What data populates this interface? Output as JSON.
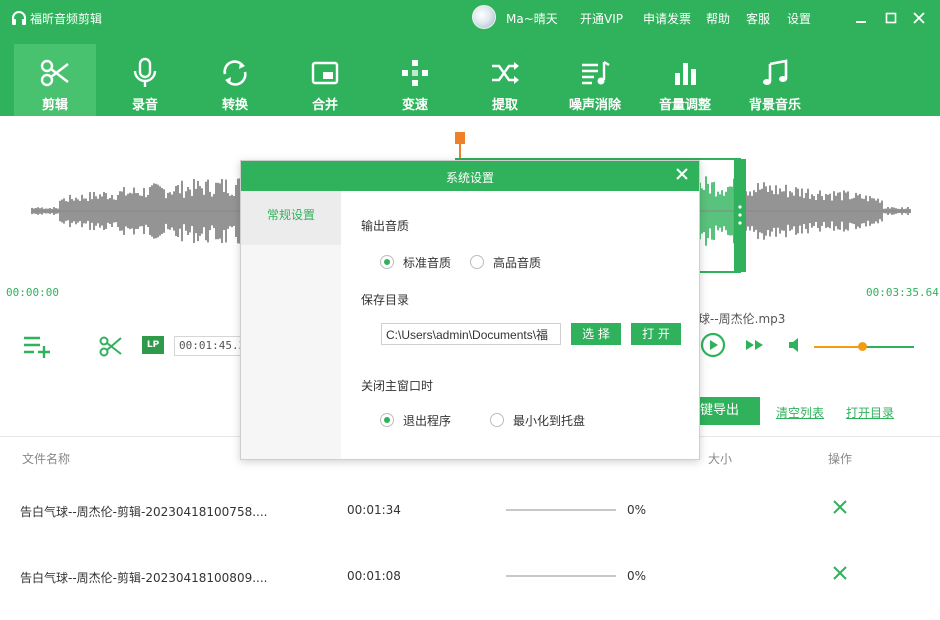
{
  "app": {
    "title": "福昕音频剪辑",
    "username": "Ma~晴天"
  },
  "top_links": [
    {
      "label": "开通VIP"
    },
    {
      "label": "申请发票"
    },
    {
      "label": "帮助"
    },
    {
      "label": "客服"
    },
    {
      "label": "设置"
    }
  ],
  "tools": [
    {
      "label": "剪辑",
      "icon": "scissors-icon",
      "active": true
    },
    {
      "label": "录音",
      "icon": "microphone-icon"
    },
    {
      "label": "转换",
      "icon": "convert-icon"
    },
    {
      "label": "合并",
      "icon": "merge-icon"
    },
    {
      "label": "变速",
      "icon": "speed-icon"
    },
    {
      "label": "提取",
      "icon": "extract-icon"
    },
    {
      "label": "噪声消除",
      "icon": "noise-icon"
    },
    {
      "label": "音量调整",
      "icon": "volume-bars-icon"
    },
    {
      "label": "背景音乐",
      "icon": "music-note-icon"
    }
  ],
  "waveform": {
    "start_time": "00:00:00",
    "end_time": "00:03:35.64"
  },
  "controls": {
    "lp_badge": "LP",
    "time_value": "00:01:45.3",
    "file_name": "球--周杰伦.mp3",
    "volume_level": 0.48
  },
  "actions": {
    "export": "键导出",
    "clear_list": "清空列表",
    "open_dir": "打开目录"
  },
  "table": {
    "headers": {
      "name": "文件名称",
      "size": "大小",
      "action": "操作"
    },
    "rows": [
      {
        "name": "告白气球--周杰伦-剪辑-20230418100758....",
        "duration": "00:01:34",
        "progress": "0%"
      },
      {
        "name": "告白气球--周杰伦-剪辑-20230418100809....",
        "duration": "00:01:08",
        "progress": "0%"
      }
    ]
  },
  "dialog": {
    "title": "系统设置",
    "side_tab": "常规设置",
    "quality_label": "输出音质",
    "quality_options": [
      {
        "label": "标准音质",
        "checked": true
      },
      {
        "label": "高品音质",
        "checked": false
      }
    ],
    "save_dir_label": "保存目录",
    "save_dir_value": "C:\\Users\\admin\\Documents\\福",
    "choose_button": "选 择",
    "open_button": "打 开",
    "close_label": "关闭主窗口时",
    "close_options": [
      {
        "label": "退出程序",
        "checked": true
      },
      {
        "label": "最小化到托盘",
        "checked": false
      }
    ]
  },
  "colors": {
    "accent": "#2fb25b",
    "wave_gray": "#7a7a7a",
    "marker": "#f07f2a"
  }
}
